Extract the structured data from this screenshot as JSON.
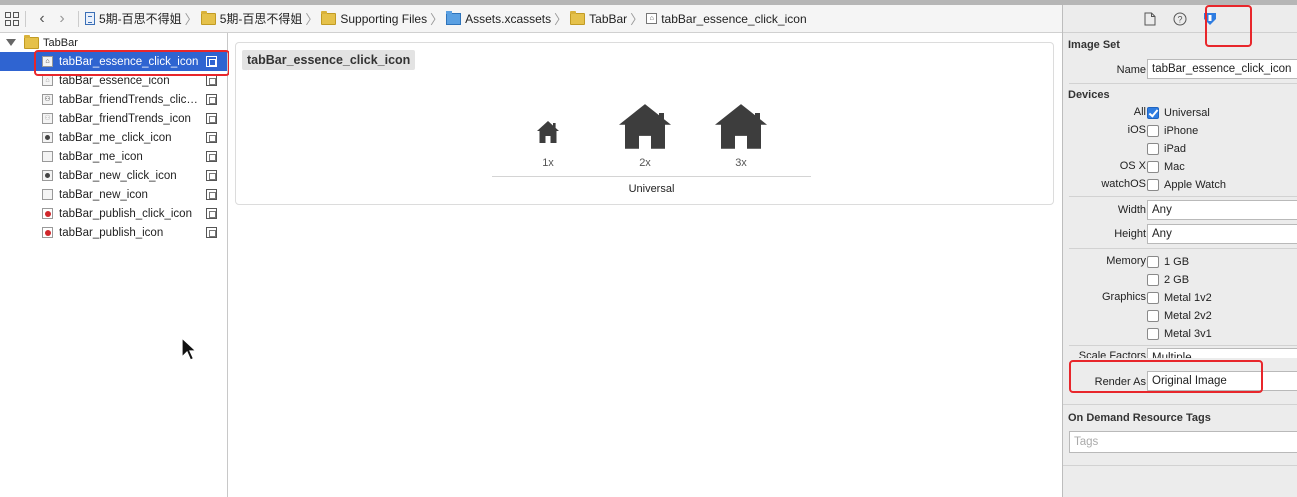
{
  "breadcrumbs": [
    {
      "label": "5期-百思不得姐",
      "icon": "project-file-icon"
    },
    {
      "label": "5期-百思不得姐",
      "icon": "folder-icon"
    },
    {
      "label": "Supporting Files",
      "icon": "folder-icon"
    },
    {
      "label": "Assets.xcassets",
      "icon": "asset-catalog-icon"
    },
    {
      "label": "TabBar",
      "icon": "folder-icon"
    },
    {
      "label": "tabBar_essence_click_icon",
      "icon": "image-set-icon"
    }
  ],
  "navigator": {
    "folder": "TabBar",
    "items": [
      {
        "label": "tabBar_essence_click_icon",
        "thumb": "house-dark",
        "selected": true
      },
      {
        "label": "tabBar_essence_icon",
        "thumb": "house-light",
        "selected": false
      },
      {
        "label": "tabBar_friendTrends_click_icon",
        "thumb": "friends-dark",
        "selected": false
      },
      {
        "label": "tabBar_friendTrends_icon",
        "thumb": "friends-light",
        "selected": false
      },
      {
        "label": "tabBar_me_click_icon",
        "thumb": "me-dark",
        "selected": false
      },
      {
        "label": "tabBar_me_icon",
        "thumb": "me-light",
        "selected": false
      },
      {
        "label": "tabBar_new_click_icon",
        "thumb": "new-dark",
        "selected": false
      },
      {
        "label": "tabBar_new_icon",
        "thumb": "new-light",
        "selected": false
      },
      {
        "label": "tabBar_publish_click_icon",
        "thumb": "publish-red",
        "selected": false
      },
      {
        "label": "tabBar_publish_icon",
        "thumb": "publish-red",
        "selected": false
      }
    ]
  },
  "editor": {
    "set_name": "tabBar_essence_click_icon",
    "slots": [
      {
        "scale": "1x"
      },
      {
        "scale": "2x"
      },
      {
        "scale": "3x"
      }
    ],
    "idiom": "Universal"
  },
  "inspector": {
    "section_image_set": "Image Set",
    "name_label": "Name",
    "name_value": "tabBar_essence_click_icon",
    "section_devices": "Devices",
    "devices": [
      {
        "label": "All",
        "option": "Universal",
        "checked": true
      },
      {
        "label": "iOS",
        "option": "iPhone",
        "checked": false
      },
      {
        "label": "",
        "option": "iPad",
        "checked": false
      },
      {
        "label": "OS X",
        "option": "Mac",
        "checked": false
      },
      {
        "label": "watchOS",
        "option": "Apple Watch",
        "checked": false
      }
    ],
    "width_label": "Width",
    "width_value": "Any",
    "height_label": "Height",
    "height_value": "Any",
    "memory_label": "Memory",
    "memory_options": [
      "1 GB",
      "2 GB"
    ],
    "graphics_label": "Graphics",
    "graphics_options": [
      "Metal 1v2",
      "Metal 2v2",
      "Metal 3v1"
    ],
    "scale_factors_label": "Scale Factors",
    "scale_factors_value": "Multiple",
    "render_as_label": "Render As",
    "render_as_value": "Original Image",
    "section_odr": "On Demand Resource Tags",
    "tags_placeholder": "Tags"
  },
  "colors": {
    "selection": "#2f64d1",
    "highlight_box": "#e8262b",
    "checkbox_on": "#2f7de1",
    "attributes_tab": "#2f7de1"
  }
}
